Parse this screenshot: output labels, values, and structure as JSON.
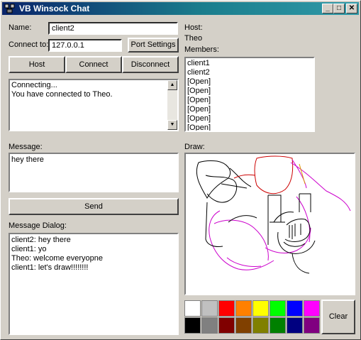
{
  "window": {
    "title": "VB Winsock Chat",
    "buttons": [
      "_",
      "□",
      "✕"
    ]
  },
  "connection": {
    "name_label": "Name:",
    "name_value": "client2",
    "connect_label": "Connect to:",
    "connect_value": "127.0.0.1",
    "port_settings_label": "Port Settings",
    "host_button": "Host",
    "connect_button": "Connect",
    "disconnect_button": "Disconnect"
  },
  "status_log": [
    "Connecting...",
    "You have connected to Theo."
  ],
  "host": {
    "label": "Host:",
    "value": "Theo",
    "members_label": "Members:"
  },
  "members": [
    "client1",
    "client2",
    "[Open]",
    "[Open]",
    "[Open]",
    "[Open]",
    "[Open]",
    "[Open]"
  ],
  "message": {
    "label": "Message:",
    "value": "hey there",
    "send_label": "Send"
  },
  "dialog": {
    "label": "Message Dialog:",
    "lines": [
      "client2: hey there",
      "client1: yo",
      "Theo: welcome everyopne",
      "client1: let's draw!!!!!!!!"
    ]
  },
  "draw": {
    "label": "Draw:",
    "clear_label": "Clear",
    "palette_top": [
      "#ffffff",
      "#c0c0c0",
      "#ff0000",
      "#ff8000",
      "#ffff00",
      "#00ff00",
      "#0000ff",
      "#ff00ff"
    ],
    "palette_bottom": [
      "#000000",
      "#808080",
      "#800000",
      "#804000",
      "#808000",
      "#008000",
      "#000080",
      "#800080"
    ]
  }
}
